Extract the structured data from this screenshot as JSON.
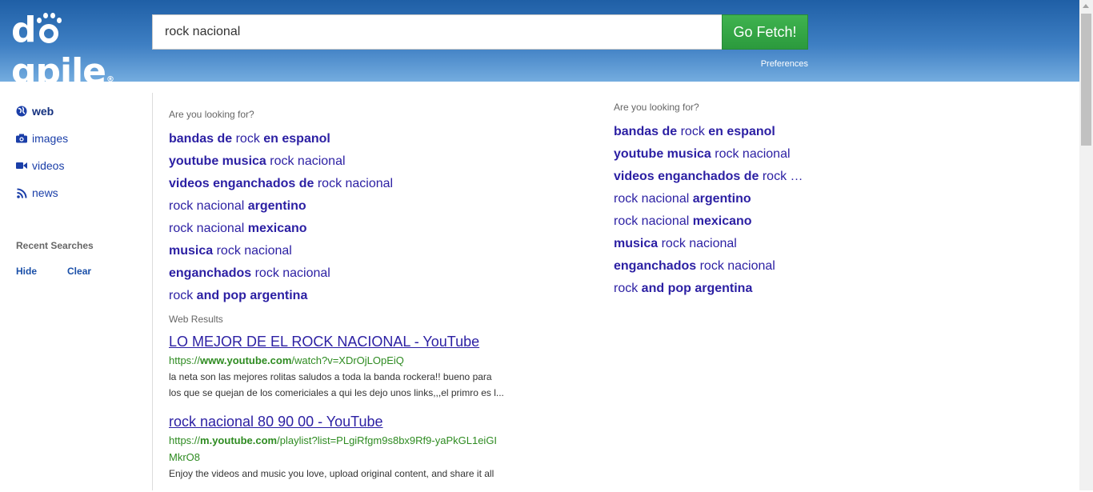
{
  "header": {
    "logo_text_a": "d",
    "logo_text_b": "gpile",
    "logo_reg": "®",
    "search_value": "rock nacional",
    "search_button": "Go Fetch!",
    "preferences": "Preferences"
  },
  "nav": {
    "items": [
      {
        "label": "web",
        "icon": "globe-icon"
      },
      {
        "label": "images",
        "icon": "camera-icon"
      },
      {
        "label": "videos",
        "icon": "video-camera-icon"
      },
      {
        "label": "news",
        "icon": "rss-icon"
      }
    ],
    "recent_title": "Recent Searches",
    "hide": "Hide",
    "clear": "Clear"
  },
  "main": {
    "looking_for": "Are you looking for?",
    "suggestions": [
      {
        "a": "bandas de",
        "b": " rock ",
        "c": "en espanol"
      },
      {
        "a": "youtube musica",
        "b": " rock nacional",
        "c": ""
      },
      {
        "a": "videos enganchados de",
        "b": " rock nacional",
        "c": ""
      },
      {
        "a": "",
        "b": "rock nacional ",
        "c": "argentino"
      },
      {
        "a": "",
        "b": "rock nacional ",
        "c": "mexicano"
      },
      {
        "a": "musica",
        "b": " rock nacional",
        "c": ""
      },
      {
        "a": "enganchados",
        "b": " rock nacional",
        "c": ""
      },
      {
        "a": "",
        "b": "rock ",
        "c": "and pop argentina"
      }
    ],
    "web_results_label": "Web Results",
    "results": [
      {
        "title": "LO MEJOR DE EL ROCK NACIONAL - YouTube",
        "url_pre": "https://",
        "url_bold": "www.youtube.com",
        "url_post": "/watch?v=XDrOjLOpEiQ",
        "desc1": "la neta son las mejores rolitas saludos a toda la banda rockera!! bueno para",
        "desc2": "los que se quejan de los comericiales a qui les dejo unos links,,,el primro es l..."
      },
      {
        "title": "rock nacional 80 90 00 - YouTube",
        "url_pre": "https://",
        "url_bold": "m.youtube.com",
        "url_post": "/playlist?list=PLgiRfgm9s8bx9Rf9-yaPkGL1eiGI",
        "url_line2": "MkrO8",
        "desc1": "Enjoy the videos and music you love, upload original content, and share it all"
      }
    ]
  },
  "right": {
    "looking_for": "Are you looking for?",
    "suggestions": [
      {
        "a": "bandas de",
        "b": " rock ",
        "c": "en espanol"
      },
      {
        "a": "youtube musica",
        "b": " rock nacional",
        "c": ""
      },
      {
        "a": "videos enganchados de",
        "b": " rock …",
        "c": ""
      },
      {
        "a": "",
        "b": "rock nacional ",
        "c": "argentino"
      },
      {
        "a": "",
        "b": "rock nacional ",
        "c": "mexicano"
      },
      {
        "a": "musica",
        "b": " rock nacional",
        "c": ""
      },
      {
        "a": "enganchados",
        "b": " rock nacional",
        "c": ""
      },
      {
        "a": "",
        "b": "rock ",
        "c": "and pop argentina"
      }
    ]
  }
}
